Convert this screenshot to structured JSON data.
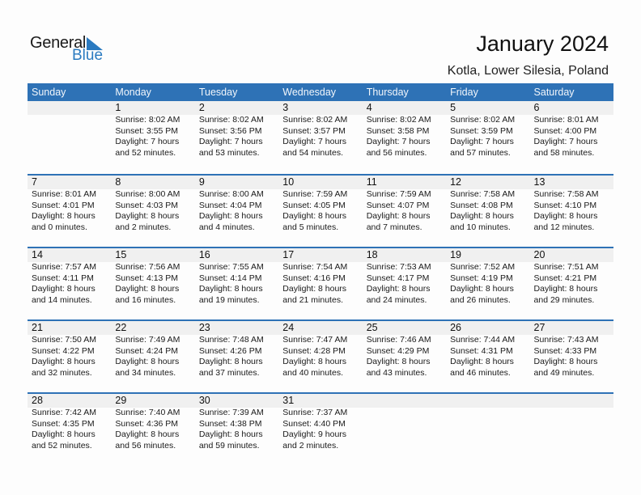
{
  "brand": {
    "word1": "General",
    "word2": "Blue",
    "accent": "#2a7ac0"
  },
  "header": {
    "title": "January 2024",
    "location": "Kotla, Lower Silesia, Poland"
  },
  "colors": {
    "header_bg": "#2e72b6",
    "band_bg": "#f0f0f0"
  },
  "weekdays": [
    "Sunday",
    "Monday",
    "Tuesday",
    "Wednesday",
    "Thursday",
    "Friday",
    "Saturday"
  ],
  "weeks": [
    [
      null,
      {
        "day": "1",
        "sunrise": "Sunrise: 8:02 AM",
        "sunset": "Sunset: 3:55 PM",
        "daylight1": "Daylight: 7 hours",
        "daylight2": "and 52 minutes."
      },
      {
        "day": "2",
        "sunrise": "Sunrise: 8:02 AM",
        "sunset": "Sunset: 3:56 PM",
        "daylight1": "Daylight: 7 hours",
        "daylight2": "and 53 minutes."
      },
      {
        "day": "3",
        "sunrise": "Sunrise: 8:02 AM",
        "sunset": "Sunset: 3:57 PM",
        "daylight1": "Daylight: 7 hours",
        "daylight2": "and 54 minutes."
      },
      {
        "day": "4",
        "sunrise": "Sunrise: 8:02 AM",
        "sunset": "Sunset: 3:58 PM",
        "daylight1": "Daylight: 7 hours",
        "daylight2": "and 56 minutes."
      },
      {
        "day": "5",
        "sunrise": "Sunrise: 8:02 AM",
        "sunset": "Sunset: 3:59 PM",
        "daylight1": "Daylight: 7 hours",
        "daylight2": "and 57 minutes."
      },
      {
        "day": "6",
        "sunrise": "Sunrise: 8:01 AM",
        "sunset": "Sunset: 4:00 PM",
        "daylight1": "Daylight: 7 hours",
        "daylight2": "and 58 minutes."
      }
    ],
    [
      {
        "day": "7",
        "sunrise": "Sunrise: 8:01 AM",
        "sunset": "Sunset: 4:01 PM",
        "daylight1": "Daylight: 8 hours",
        "daylight2": "and 0 minutes."
      },
      {
        "day": "8",
        "sunrise": "Sunrise: 8:00 AM",
        "sunset": "Sunset: 4:03 PM",
        "daylight1": "Daylight: 8 hours",
        "daylight2": "and 2 minutes."
      },
      {
        "day": "9",
        "sunrise": "Sunrise: 8:00 AM",
        "sunset": "Sunset: 4:04 PM",
        "daylight1": "Daylight: 8 hours",
        "daylight2": "and 4 minutes."
      },
      {
        "day": "10",
        "sunrise": "Sunrise: 7:59 AM",
        "sunset": "Sunset: 4:05 PM",
        "daylight1": "Daylight: 8 hours",
        "daylight2": "and 5 minutes."
      },
      {
        "day": "11",
        "sunrise": "Sunrise: 7:59 AM",
        "sunset": "Sunset: 4:07 PM",
        "daylight1": "Daylight: 8 hours",
        "daylight2": "and 7 minutes."
      },
      {
        "day": "12",
        "sunrise": "Sunrise: 7:58 AM",
        "sunset": "Sunset: 4:08 PM",
        "daylight1": "Daylight: 8 hours",
        "daylight2": "and 10 minutes."
      },
      {
        "day": "13",
        "sunrise": "Sunrise: 7:58 AM",
        "sunset": "Sunset: 4:10 PM",
        "daylight1": "Daylight: 8 hours",
        "daylight2": "and 12 minutes."
      }
    ],
    [
      {
        "day": "14",
        "sunrise": "Sunrise: 7:57 AM",
        "sunset": "Sunset: 4:11 PM",
        "daylight1": "Daylight: 8 hours",
        "daylight2": "and 14 minutes."
      },
      {
        "day": "15",
        "sunrise": "Sunrise: 7:56 AM",
        "sunset": "Sunset: 4:13 PM",
        "daylight1": "Daylight: 8 hours",
        "daylight2": "and 16 minutes."
      },
      {
        "day": "16",
        "sunrise": "Sunrise: 7:55 AM",
        "sunset": "Sunset: 4:14 PM",
        "daylight1": "Daylight: 8 hours",
        "daylight2": "and 19 minutes."
      },
      {
        "day": "17",
        "sunrise": "Sunrise: 7:54 AM",
        "sunset": "Sunset: 4:16 PM",
        "daylight1": "Daylight: 8 hours",
        "daylight2": "and 21 minutes."
      },
      {
        "day": "18",
        "sunrise": "Sunrise: 7:53 AM",
        "sunset": "Sunset: 4:17 PM",
        "daylight1": "Daylight: 8 hours",
        "daylight2": "and 24 minutes."
      },
      {
        "day": "19",
        "sunrise": "Sunrise: 7:52 AM",
        "sunset": "Sunset: 4:19 PM",
        "daylight1": "Daylight: 8 hours",
        "daylight2": "and 26 minutes."
      },
      {
        "day": "20",
        "sunrise": "Sunrise: 7:51 AM",
        "sunset": "Sunset: 4:21 PM",
        "daylight1": "Daylight: 8 hours",
        "daylight2": "and 29 minutes."
      }
    ],
    [
      {
        "day": "21",
        "sunrise": "Sunrise: 7:50 AM",
        "sunset": "Sunset: 4:22 PM",
        "daylight1": "Daylight: 8 hours",
        "daylight2": "and 32 minutes."
      },
      {
        "day": "22",
        "sunrise": "Sunrise: 7:49 AM",
        "sunset": "Sunset: 4:24 PM",
        "daylight1": "Daylight: 8 hours",
        "daylight2": "and 34 minutes."
      },
      {
        "day": "23",
        "sunrise": "Sunrise: 7:48 AM",
        "sunset": "Sunset: 4:26 PM",
        "daylight1": "Daylight: 8 hours",
        "daylight2": "and 37 minutes."
      },
      {
        "day": "24",
        "sunrise": "Sunrise: 7:47 AM",
        "sunset": "Sunset: 4:28 PM",
        "daylight1": "Daylight: 8 hours",
        "daylight2": "and 40 minutes."
      },
      {
        "day": "25",
        "sunrise": "Sunrise: 7:46 AM",
        "sunset": "Sunset: 4:29 PM",
        "daylight1": "Daylight: 8 hours",
        "daylight2": "and 43 minutes."
      },
      {
        "day": "26",
        "sunrise": "Sunrise: 7:44 AM",
        "sunset": "Sunset: 4:31 PM",
        "daylight1": "Daylight: 8 hours",
        "daylight2": "and 46 minutes."
      },
      {
        "day": "27",
        "sunrise": "Sunrise: 7:43 AM",
        "sunset": "Sunset: 4:33 PM",
        "daylight1": "Daylight: 8 hours",
        "daylight2": "and 49 minutes."
      }
    ],
    [
      {
        "day": "28",
        "sunrise": "Sunrise: 7:42 AM",
        "sunset": "Sunset: 4:35 PM",
        "daylight1": "Daylight: 8 hours",
        "daylight2": "and 52 minutes."
      },
      {
        "day": "29",
        "sunrise": "Sunrise: 7:40 AM",
        "sunset": "Sunset: 4:36 PM",
        "daylight1": "Daylight: 8 hours",
        "daylight2": "and 56 minutes."
      },
      {
        "day": "30",
        "sunrise": "Sunrise: 7:39 AM",
        "sunset": "Sunset: 4:38 PM",
        "daylight1": "Daylight: 8 hours",
        "daylight2": "and 59 minutes."
      },
      {
        "day": "31",
        "sunrise": "Sunrise: 7:37 AM",
        "sunset": "Sunset: 4:40 PM",
        "daylight1": "Daylight: 9 hours",
        "daylight2": "and 2 minutes."
      },
      null,
      null,
      null
    ]
  ]
}
